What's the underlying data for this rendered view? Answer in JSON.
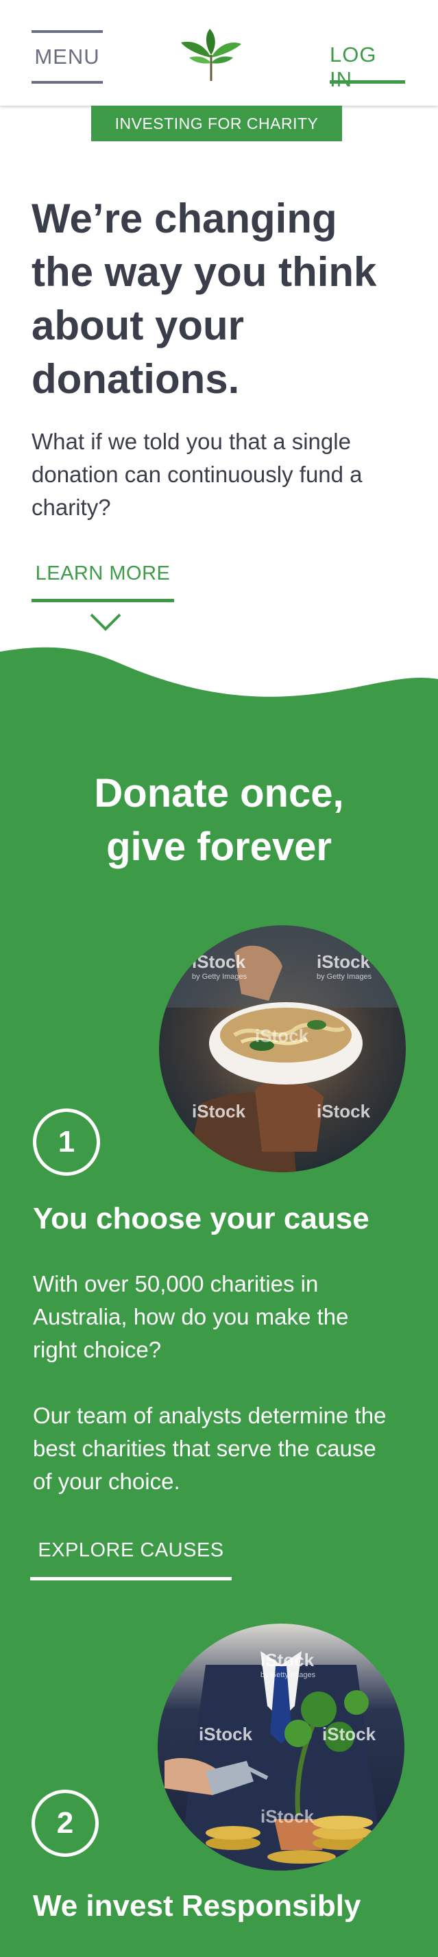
{
  "header": {
    "menu_label": "MENU",
    "login_label": "LOG IN",
    "logo_icon": "plant-leaves-icon"
  },
  "tag": "INVESTING FOR CHARITY",
  "hero": {
    "title_lines": [
      "We’re changing",
      "the way you think",
      "about your",
      "donations."
    ],
    "text": "What if we told you that a single donation can continuously fund a charity?",
    "learn_more_label": "LEARN MORE",
    "scroll_icon": "chevron-down-icon"
  },
  "colors": {
    "brand_green": "#3d9b47",
    "text_dark": "#3a3d4a",
    "menu_grey": "#6a6e80"
  },
  "how_it_works": {
    "title_lines": [
      "Donate once,",
      "give forever"
    ],
    "steps": [
      {
        "number": "1",
        "title": "You choose your cause",
        "paragraphs": [
          "With over 50,000 charities in Australia, how do you make the right choice?",
          "Our team of analysts determine the best charities that serve the cause of your choice."
        ],
        "button_label": "EXPLORE CAUSES",
        "image_watermark": "iStock",
        "image_watermark_sub": "by Getty Images"
      },
      {
        "number": "2",
        "title": "We invest Responsibly",
        "image_watermark": "iStock",
        "image_watermark_sub": "by Getty Images"
      }
    ]
  }
}
